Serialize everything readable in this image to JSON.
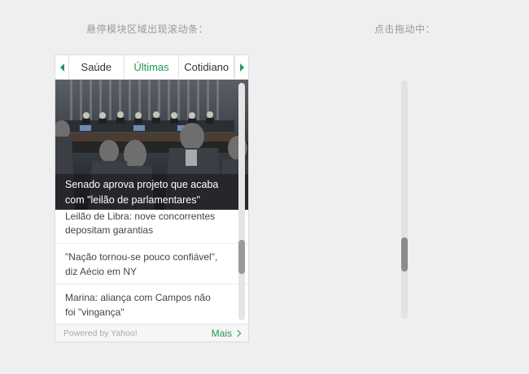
{
  "captions": {
    "left": "悬停模块区域出现滚动条：",
    "right": "点击拖动中："
  },
  "widget": {
    "tabs": [
      {
        "label": "Saúde",
        "active": false
      },
      {
        "label": "Últimas",
        "active": true
      },
      {
        "label": "Cotidiano",
        "active": false
      }
    ],
    "hero": {
      "title_line1": "Senado aprova projeto que acaba",
      "title_line2": "com \"leilão de parlamentares\""
    },
    "news": [
      {
        "line1": "Leilão de Libra: nove concorrentes",
        "line2": "depositam garantias"
      },
      {
        "line1": "\"Nação tornou-se pouco confiável\",",
        "line2": "diz Aécio em NY"
      },
      {
        "line1": "Marina: aliança com Campos não",
        "line2": "foi \"vingança\""
      }
    ],
    "scroll_position": 0.77,
    "footer": {
      "powered": "Powered by Yahoo!",
      "more": "Mais"
    },
    "accent_color": "#1f9a55",
    "icons": {
      "prev": "triangle-left-icon",
      "next": "triangle-right-icon",
      "more": "chevron-right-icon"
    }
  },
  "demo_scrollbar": {
    "scroll_position": 0.77
  }
}
